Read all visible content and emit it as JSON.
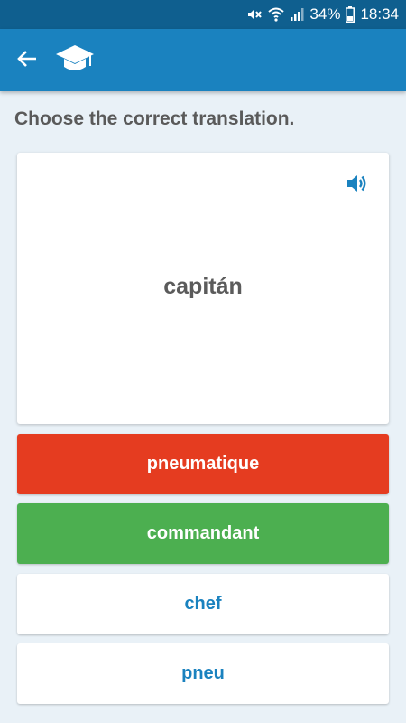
{
  "status_bar": {
    "battery_percent": "34%",
    "time": "18:34",
    "icons": [
      "mute-icon",
      "wifi-icon",
      "signal-icon",
      "battery-icon"
    ]
  },
  "app_bar": {
    "back_icon": "back-arrow-icon",
    "logo_icon": "graduation-cap-icon",
    "color": "#1a82bf"
  },
  "quiz": {
    "instruction": "Choose the correct translation.",
    "word": "capitán",
    "speaker_icon": "speaker-icon",
    "options": [
      {
        "label": "pneumatique",
        "state": "wrong",
        "color": "#e53c20"
      },
      {
        "label": "commandant",
        "state": "correct",
        "color": "#4caf50"
      },
      {
        "label": "chef",
        "state": "neutral",
        "color": "#ffffff"
      },
      {
        "label": "pneu",
        "state": "neutral",
        "color": "#ffffff"
      }
    ]
  }
}
